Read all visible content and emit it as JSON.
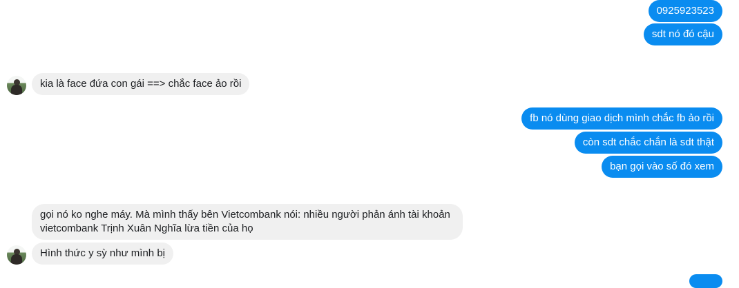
{
  "conversation": {
    "messages": [
      {
        "sender": "me",
        "text": "0925923523"
      },
      {
        "sender": "me",
        "text": "sdt nó đó cậu"
      },
      {
        "sender": "other",
        "text": "kia là face đứa con gái ==> chắc face ảo rồi"
      },
      {
        "sender": "me",
        "text": "fb nó dùng giao dịch mình chắc fb ảo rồi"
      },
      {
        "sender": "me",
        "text": "còn sdt chắc chắn là sdt thật"
      },
      {
        "sender": "me",
        "text": "bạn gọi vào số đó xem"
      },
      {
        "sender": "other",
        "text": "gọi nó ko nghe máy. Mà mình thấy bên Vietcombank nói:  nhiều người phản ánh tài khoản vietcombank Trịnh Xuân Nghĩa lừa tiền của họ"
      },
      {
        "sender": "other",
        "text": "Hình thức y sỳ như mình bị"
      }
    ]
  },
  "colors": {
    "outgoing_bubble": "#0a8cf0",
    "incoming_bubble": "#f0f0f0",
    "outgoing_text": "#ffffff",
    "incoming_text": "#1c1e21"
  },
  "icons": {
    "contact_avatar": "avatar-photo"
  }
}
